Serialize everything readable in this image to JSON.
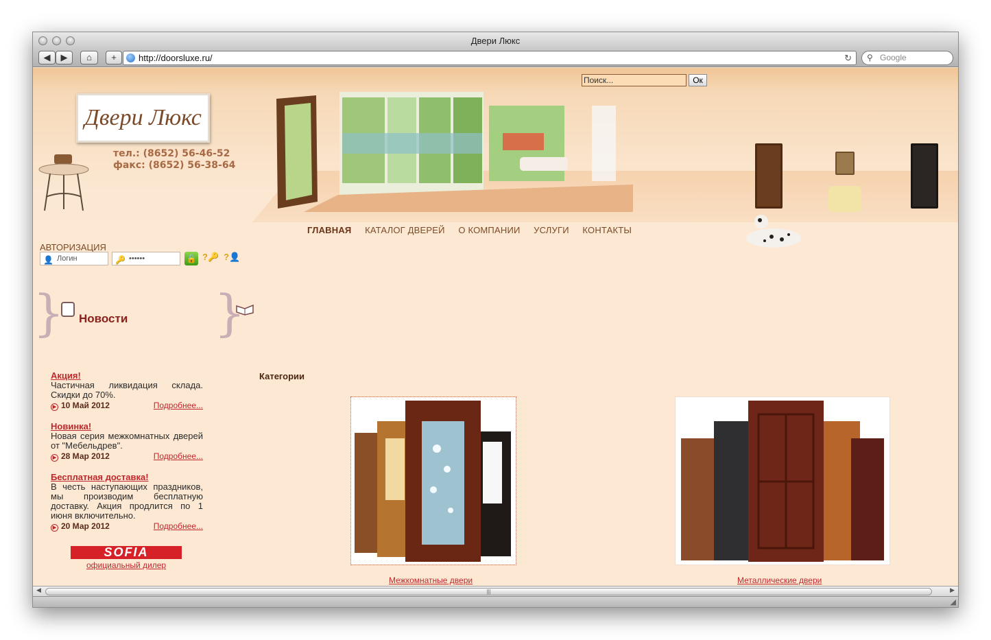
{
  "window": {
    "title": "Двери Люкс"
  },
  "toolbar": {
    "url": "http://doorsluxe.ru/",
    "google_placeholder": "Google"
  },
  "site": {
    "search": {
      "placeholder": "Поиск...",
      "button": "Ок"
    },
    "logo": "Двери Люкс",
    "phone": "тел.: (8652) 56-46-52",
    "fax": "факс: (8652) 56-38-64",
    "nav": [
      "ГЛАВНАЯ",
      "КАТАЛОГ ДВЕРЕЙ",
      "О КОМПАНИИ",
      "УСЛУГИ",
      "КОНТАКТЫ"
    ],
    "auth": {
      "title": "АВТОРИЗАЦИЯ",
      "login_placeholder": "Логин",
      "password_value": "••••••"
    },
    "news": {
      "title": "Новости",
      "items": [
        {
          "headline": "Акция!",
          "text": "Частичная ликвидация склада. Скидки до 70%.",
          "date": "10 Май 2012",
          "more": "Подробнее..."
        },
        {
          "headline": "Новинка!",
          "text": "Новая серия межкомнатных дверей от \"Мебельдрев\".",
          "date": "28 Мар 2012",
          "more": "Подробнее..."
        },
        {
          "headline": "Бесплатная доставка!",
          "text": "В честь наступающих праздников, мы производим бесплатную доставку. Акция продлится по 1 июня включительно.",
          "date": "20 Мар 2012",
          "more": "Подробнее..."
        }
      ]
    },
    "dealer": {
      "brand": "SOFIA",
      "caption": "официальный дилер"
    },
    "categories": {
      "title": "Категории",
      "items": [
        {
          "label": "Межкомнатные двери "
        },
        {
          "label": "Металлические двери "
        }
      ]
    }
  },
  "colors": {
    "accent": "#c0262c",
    "nav": "#7b4a26",
    "background": "#fde9d3"
  }
}
